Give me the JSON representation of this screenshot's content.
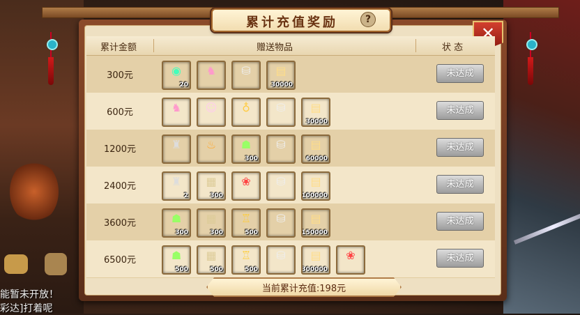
{
  "window": {
    "title": "累计充值奖励",
    "help_icon": "?",
    "close_icon": "✕"
  },
  "table": {
    "headers": [
      "累计金额",
      "赠送物品",
      "状 态"
    ],
    "rows": [
      {
        "amount": "300元",
        "status": "未达成",
        "items": [
          {
            "icon": "jade-orb-icon",
            "count": "20",
            "tag": "",
            "bg": "#3a4a2a",
            "glyph": "◉",
            "color": "#4fb"
          },
          {
            "icon": "pink-steed-icon",
            "count": "",
            "tag": "",
            "bg": "#5a3a3a",
            "glyph": "♞",
            "color": "#f9c"
          },
          {
            "icon": "silver-ingot-icon",
            "count": "",
            "tag": "",
            "bg": "#6a5a48",
            "glyph": "⛁",
            "color": "#eee"
          },
          {
            "icon": "gold-ticket-icon",
            "count": "30000",
            "tag": "",
            "bg": "#a87a3a",
            "glyph": "▤",
            "color": "#fd8"
          }
        ]
      },
      {
        "amount": "600元",
        "status": "未达成",
        "items": [
          {
            "icon": "pink-steed-icon",
            "count": "",
            "tag": "",
            "bg": "#5a3a3a",
            "glyph": "♞",
            "color": "#f9c"
          },
          {
            "icon": "hero-portrait-icon",
            "count": "",
            "tag": "",
            "bg": "#8a5a9a",
            "glyph": "☺",
            "color": "#fce"
          },
          {
            "icon": "gourd-item-icon",
            "count": "",
            "tag": "",
            "bg": "#2a5a8a",
            "glyph": "♁",
            "color": "#fc4"
          },
          {
            "icon": "silver-ingot-icon",
            "count": "",
            "tag": "",
            "bg": "#6a5a48",
            "glyph": "⛁",
            "color": "#eee"
          },
          {
            "icon": "gold-ticket-icon",
            "count": "30000",
            "tag": "",
            "bg": "#a87a3a",
            "glyph": "▤",
            "color": "#fd8"
          }
        ]
      },
      {
        "amount": "1200元",
        "status": "未达成",
        "items": [
          {
            "icon": "warrior-portrait-icon",
            "count": "",
            "tag": "",
            "bg": "#4a3a2a",
            "glyph": "♜",
            "color": "#ddd"
          },
          {
            "icon": "flame-warrior-icon",
            "count": "",
            "tag": "",
            "bg": "#7a2a10",
            "glyph": "♨",
            "color": "#fa3"
          },
          {
            "icon": "sage-card-icon",
            "count": "300",
            "tag": "",
            "bg": "#3a2a6a",
            "glyph": "☗",
            "color": "#9f6"
          },
          {
            "icon": "silver-ingot-icon",
            "count": "",
            "tag": "",
            "bg": "#6a5a48",
            "glyph": "⛁",
            "color": "#eee"
          },
          {
            "icon": "gold-ticket-icon",
            "count": "60000",
            "tag": "",
            "bg": "#a87a3a",
            "glyph": "▤",
            "color": "#fd8"
          }
        ]
      },
      {
        "amount": "2400元",
        "status": "未达成",
        "items": [
          {
            "icon": "warrior-portrait-icon",
            "count": "2",
            "tag": "",
            "bg": "#4a3a2a",
            "glyph": "♜",
            "color": "#ddd"
          },
          {
            "icon": "scroll-map-icon",
            "count": "300",
            "tag": "",
            "bg": "#6a5a2a",
            "glyph": "▦",
            "color": "#dc9"
          },
          {
            "icon": "red-berries-icon",
            "count": "",
            "tag": "",
            "bg": "#3a1a1a",
            "glyph": "❀",
            "color": "#f44"
          },
          {
            "icon": "silver-ingot-icon",
            "count": "",
            "tag": "",
            "bg": "#6a5a48",
            "glyph": "⛁",
            "color": "#eee"
          },
          {
            "icon": "gold-ticket-icon",
            "count": "100000",
            "tag": "",
            "bg": "#a87a3a",
            "glyph": "▤",
            "color": "#fd8"
          }
        ]
      },
      {
        "amount": "3600元",
        "status": "未达成",
        "items": [
          {
            "icon": "sage-card-icon",
            "count": "300",
            "tag": "",
            "bg": "#3a2a6a",
            "glyph": "☗",
            "color": "#9f6"
          },
          {
            "icon": "scroll-map-icon",
            "count": "300",
            "tag": "",
            "bg": "#6a5a2a",
            "glyph": "▦",
            "color": "#dc9"
          },
          {
            "icon": "golden-pagoda-icon",
            "count": "500",
            "tag": "",
            "bg": "#4a2a6a",
            "glyph": "♖",
            "color": "#fc3"
          },
          {
            "icon": "silver-ingot-icon",
            "count": "",
            "tag": "",
            "bg": "#6a5a48",
            "glyph": "⛁",
            "color": "#eee"
          },
          {
            "icon": "gold-ticket-icon",
            "count": "150000",
            "tag": "",
            "bg": "#a87a3a",
            "glyph": "▤",
            "color": "#fd8"
          }
        ]
      },
      {
        "amount": "6500元",
        "status": "未达成",
        "items": [
          {
            "icon": "sage-card-icon",
            "count": "500",
            "tag": "",
            "bg": "#3a2a6a",
            "glyph": "☗",
            "color": "#9f6"
          },
          {
            "icon": "scroll-map-icon",
            "count": "500",
            "tag": "",
            "bg": "#6a5a2a",
            "glyph": "▦",
            "color": "#dc9"
          },
          {
            "icon": "golden-pagoda-icon",
            "count": "500",
            "tag": "",
            "bg": "#4a2a6a",
            "glyph": "♖",
            "color": "#fc3"
          },
          {
            "icon": "silver-ingot-icon",
            "count": "",
            "tag": "",
            "bg": "#6a5a48",
            "glyph": "⛁",
            "color": "#eee"
          },
          {
            "icon": "gold-ticket-icon",
            "count": "300000",
            "tag": "",
            "bg": "#a87a3a",
            "glyph": "▤",
            "color": "#fd8"
          },
          {
            "icon": "red-berries-icon",
            "count": "",
            "tag": "",
            "bg": "#3a1a1a",
            "glyph": "❀",
            "color": "#f44"
          }
        ]
      }
    ]
  },
  "footer": {
    "total_text": "当前累计充值:198元"
  },
  "background": {
    "chat_line_1": "能暂未开放！",
    "chat_line_2": "彩达]打着呢"
  }
}
